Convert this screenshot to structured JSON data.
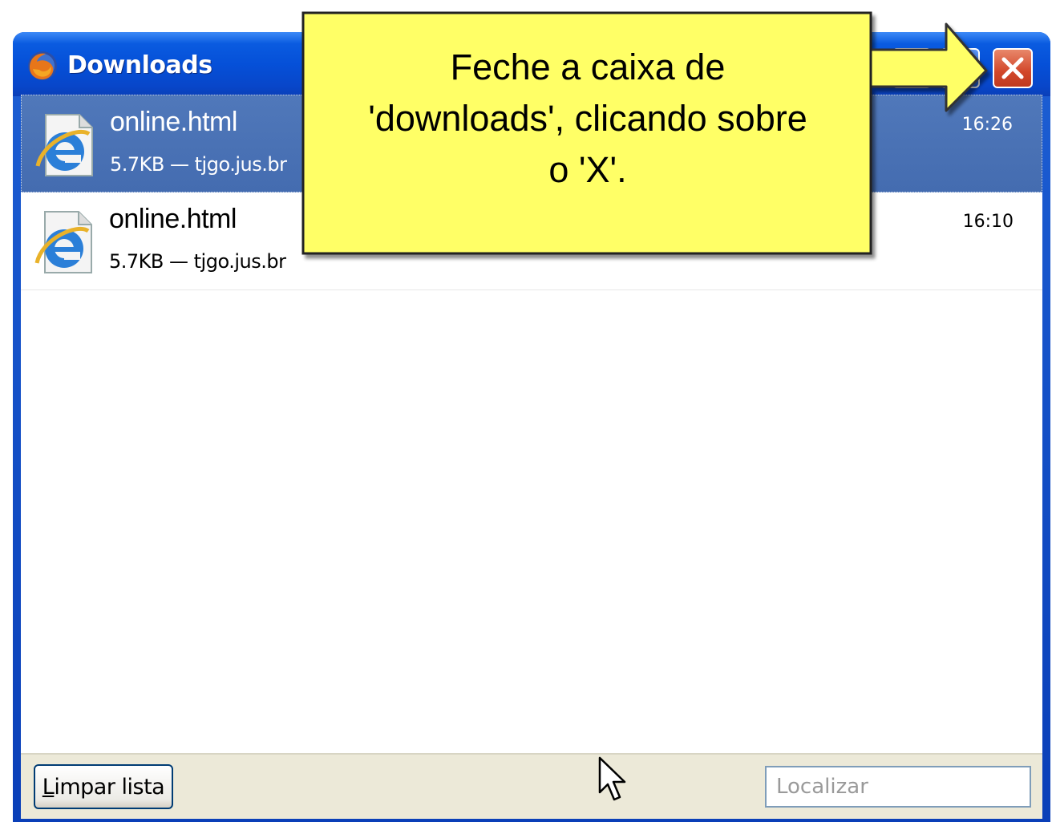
{
  "window": {
    "title": "Downloads",
    "app_icon": "firefox-icon",
    "controls": [
      "minimize-icon",
      "maximize-icon",
      "close-icon"
    ]
  },
  "downloads": [
    {
      "name": "online.html",
      "meta": "5.7KB — tjgo.jus.br",
      "time": "16:26",
      "icon": "internet-explorer-icon",
      "selected": true
    },
    {
      "name": "online.html",
      "meta": "5.7KB — tjgo.jus.br",
      "time": "16:10",
      "icon": "internet-explorer-icon",
      "selected": false
    }
  ],
  "footer": {
    "clear_button_first": "L",
    "clear_button_rest": "impar lista",
    "search_placeholder": "Localizar"
  },
  "callout": {
    "line1": "Feche a caixa de",
    "line2": "'downloads', clicando sobre",
    "line3": "o 'X'."
  },
  "colors": {
    "titlebar": "#0550d8",
    "selected_row": "#4a72b5",
    "callout_fill": "#ffff66",
    "close_button": "#d2472a"
  }
}
